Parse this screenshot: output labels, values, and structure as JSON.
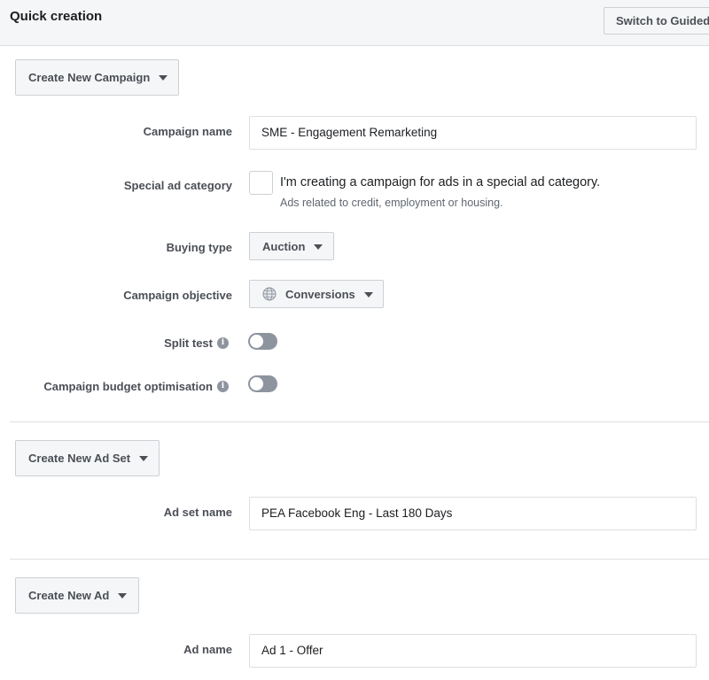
{
  "header": {
    "title": "Quick creation",
    "switch_label": "Switch to Guided"
  },
  "campaign": {
    "create_label": "Create New Campaign",
    "name_label": "Campaign name",
    "name_value": "SME - Engagement Remarketing",
    "special_ad_label": "Special ad category",
    "special_ad_checkbox_text": "I'm creating a campaign for ads in a special ad category.",
    "special_ad_hint": "Ads related to credit, employment or housing.",
    "special_ad_checked": false,
    "buying_type_label": "Buying type",
    "buying_type_value": "Auction",
    "objective_label": "Campaign objective",
    "objective_value": "Conversions",
    "objective_icon": "globe-icon",
    "split_test_label": "Split test",
    "split_test_enabled": false,
    "budget_opt_label": "Campaign budget optimisation",
    "budget_opt_enabled": false
  },
  "ad_set": {
    "create_label": "Create New Ad Set",
    "name_label": "Ad set name",
    "name_value": "PEA Facebook Eng - Last 180 Days"
  },
  "ad": {
    "create_label": "Create New Ad",
    "name_label": "Ad name",
    "name_value": "Ad 1 - Offer"
  },
  "colors": {
    "header_bg": "#f5f6f7",
    "border": "#dddfe2",
    "toggle_off": "#8d949e",
    "label_text": "#4b4f56"
  }
}
